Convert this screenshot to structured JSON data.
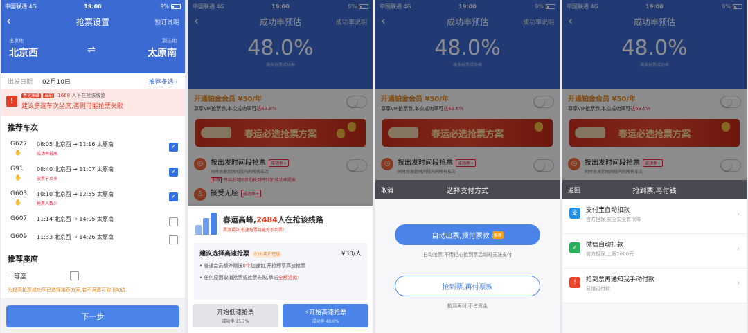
{
  "status": {
    "carrier": "中国联通",
    "network": "4G",
    "time": "19:00",
    "battery": "9%"
  },
  "p1": {
    "title": "抢票设置",
    "right": "预订说明",
    "from_label": "出发地",
    "to_label": "到达地",
    "from": "北京西",
    "to": "太原南",
    "swap": "⇌",
    "date_label": "出发日期",
    "date": "02月10日",
    "more": "推荐多选 ›",
    "warn_tag": "春运高峰",
    "warn_line1_a": "当前",
    "warn_count": "1668",
    "warn_line1_b": "人下在抢该线路",
    "warn_line2": "建议多选车次坐席,否则可能抢票失败",
    "trains_title": "推荐车次",
    "trains": [
      {
        "no": "G627",
        "time": "08:05 北京西 → 11:16 太原南",
        "note": "成功率最高",
        "checked": true
      },
      {
        "no": "G91",
        "time": "08:40 北京西 → 11:07 太原南",
        "note": "放票节点多",
        "checked": true
      },
      {
        "no": "G603",
        "time": "10:10 北京西 → 12:55 太原南",
        "note": "抢票人数少",
        "checked": true
      },
      {
        "no": "G607",
        "time": "11:14 北京西 → 14:05 太原南",
        "note": "",
        "checked": false
      },
      {
        "no": "G609",
        "time": "11:33 北京西 → 14:26 太原南",
        "note": "",
        "checked": false
      }
    ],
    "seats_title": "推荐座席",
    "seat": "一等座",
    "note": "为提高抢票成功率已选择推荐方案,若不满意可取消勾选",
    "next": "下一步"
  },
  "p2": {
    "title": "成功率预估",
    "right": "成功率说明",
    "rate": "48.0%",
    "rate_sub": "满多抢票成功率",
    "vip_title": "开通铂金会员 ¥50/年",
    "vip_desc_a": "尊享VIP抢票券,本次成功率可",
    "vip_desc_b": "达63.8%",
    "banner": "春运必选抢票方案",
    "opt1_title": "按出发时间段抢票",
    "opt1_tag": "成功率+",
    "opt1_sub": "同时抢按您时间段内的所有车次",
    "opt1_effect_tag": "推荐",
    "opt1_effect": "开启后可同步加抢到开列车,成功率提高",
    "opt2_title": "接受无座",
    "opt2_tag": "成功率+",
    "peak_a": "春运高峰,",
    "peak_count": "2484",
    "peak_b": "人在抢该线路",
    "peak_sub": "票源紧张,低速抢票可能抢不到票!",
    "rec_title": "建议选择高速抢票",
    "rec_tag": "83%用户已选",
    "rec_price": "¥30/人",
    "rec_li1_a": "• 普通会员额外赠送",
    "rec_li1_b": "0个",
    "rec_li1_c": "加速包,开抢即享高速抢票",
    "rec_li2_a": "• 任何原因取消抢票或抢票失败,承诺",
    "rec_li2_b": "全额退款",
    "rec_li2_c": "!",
    "btn_low": "开始低速抢票",
    "btn_low_sub": "成功率 15.7%",
    "btn_high": "⚡开始高速抢票",
    "btn_high_sub": "成功率 48.0%"
  },
  "p3": {
    "bar_left": "取消",
    "bar_title": "选择支付方式",
    "auto": "自动出票,预付票款",
    "auto_tag": "推荐",
    "auto_sub": "自动抢票,不用担心抢到票后超时无法支付",
    "later": "抢到票,再付票款",
    "later_sub": "抢到再付,不占资金"
  },
  "p4": {
    "bar_left": "返回",
    "bar_title": "抢到票,再付钱",
    "pays": [
      {
        "icon": "支",
        "title": "支付宝自动扣款",
        "sub": "官方担保,安全安全有保障",
        "color": "#1e8ee6"
      },
      {
        "icon": "✓",
        "title": "微信自动扣款",
        "sub": "官方担保,上限2000元",
        "color": "#2aae5c"
      },
      {
        "icon": "!",
        "title": "抢到票再通知我手动付款",
        "sub": "易错过付款",
        "color": "#e8472d"
      }
    ]
  }
}
